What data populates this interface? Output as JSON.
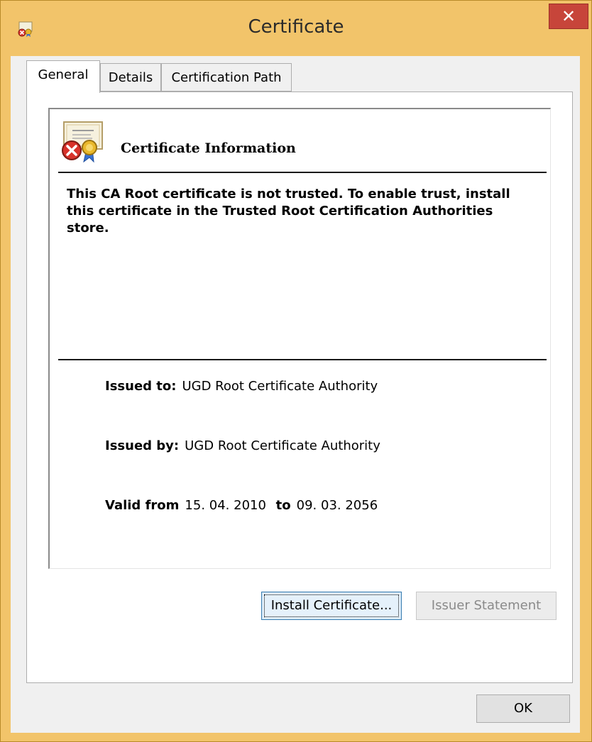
{
  "window": {
    "title": "Certificate",
    "close_glyph": "✕",
    "accent": "#f2c46a",
    "close_color": "#c7453a"
  },
  "tabs": [
    {
      "label": "General",
      "active": true
    },
    {
      "label": "Details",
      "active": false
    },
    {
      "label": "Certification Path",
      "active": false
    }
  ],
  "info": {
    "heading": "Certificate Information",
    "icon": "certificate-error-icon",
    "warning": "This CA Root certificate is not trusted. To enable trust, install this certificate in the Trusted Root Certification Authorities store.",
    "issued_to_label": "Issued to:",
    "issued_to_value": "UGD Root Certificate Authority",
    "issued_by_label": "Issued by:",
    "issued_by_value": "UGD Root Certificate Authority",
    "valid_from_label": "Valid from",
    "valid_from_value": "15. 04. 2010",
    "valid_to_label": "to",
    "valid_to_value": "09. 03. 2056"
  },
  "buttons": {
    "install": "Install Certificate...",
    "issuer_statement": "Issuer Statement",
    "ok": "OK"
  }
}
